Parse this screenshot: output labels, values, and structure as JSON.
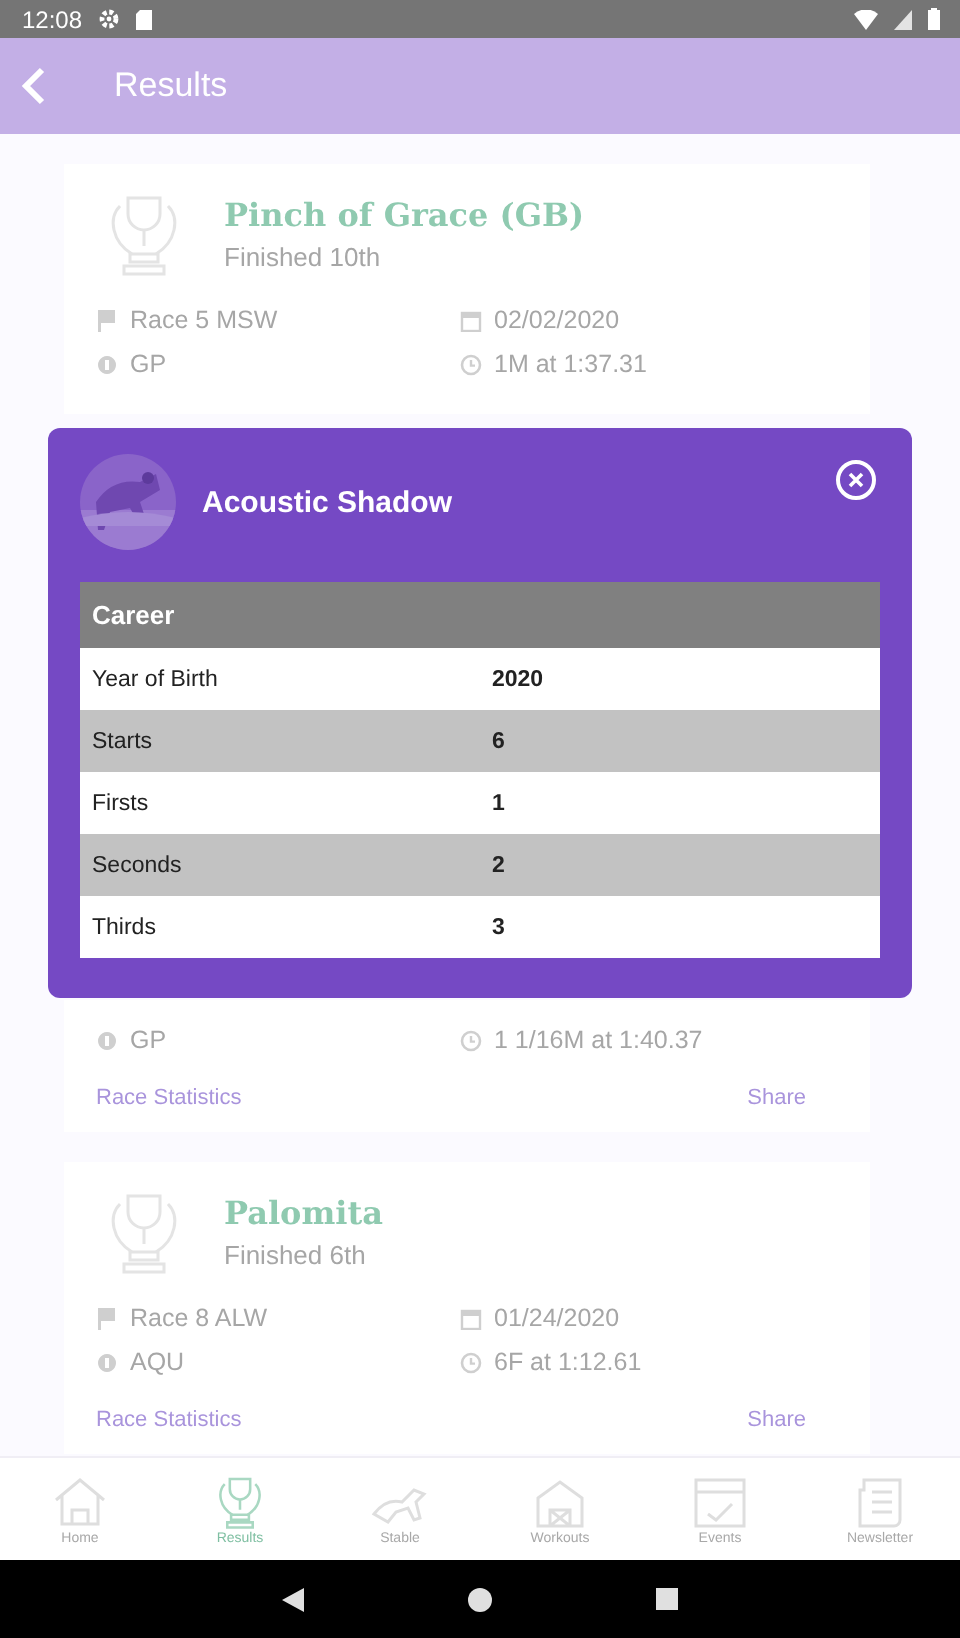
{
  "status_bar": {
    "time": "12:08"
  },
  "app_bar": {
    "title": "Results"
  },
  "results": [
    {
      "horse": "Pinch of Grace (GB)",
      "finish": "Finished 10th",
      "race": "Race 5 MSW",
      "date": "02/02/2020",
      "track": "GP",
      "distance": "1M at 1:37.31"
    },
    {
      "track": "GP",
      "distance": "1 1/16M at 1:40.37",
      "actions": [
        "Race Statistics",
        "Share"
      ]
    },
    {
      "horse": "Palomita",
      "finish": "Finished 6th",
      "race": "Race 8 ALW",
      "date": "01/24/2020",
      "track": "AQU",
      "distance": "6F at 1:12.61",
      "actions": [
        "Race Statistics",
        "Share"
      ]
    }
  ],
  "modal": {
    "title": "Acoustic Shadow",
    "table": {
      "heading": "Career",
      "rows": [
        {
          "label": "Year of Birth",
          "value": "2020"
        },
        {
          "label": "Starts",
          "value": "6"
        },
        {
          "label": "Firsts",
          "value": "1"
        },
        {
          "label": "Seconds",
          "value": "2"
        },
        {
          "label": "Thirds",
          "value": "3"
        }
      ]
    }
  },
  "bottom_nav": [
    {
      "label": "Home",
      "selected": false
    },
    {
      "label": "Results",
      "selected": true
    },
    {
      "label": "Stable",
      "selected": false
    },
    {
      "label": "Workouts",
      "selected": false
    },
    {
      "label": "Events",
      "selected": false
    },
    {
      "label": "Newsletter",
      "selected": false
    }
  ]
}
